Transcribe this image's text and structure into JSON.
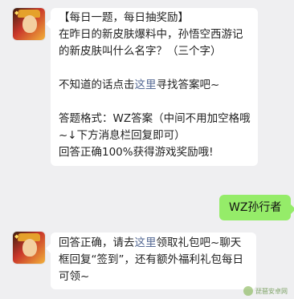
{
  "messages": {
    "first": {
      "title": "【每日一题，每日抽奖励】",
      "question": "在昨日的新皮肤爆料中，孙悟空西游记的新皮肤叫什么名字？（三个字）",
      "hint_before": "不知道的话点击",
      "hint_link": "这里",
      "hint_after": "寻找答案吧~",
      "format_text": "答题格式：WZ答案（中间不用加空格哦~↓下方消息栏回复即可）",
      "reward_text": "回答正确100%获得游戏奖励哦!"
    },
    "reply": {
      "text": "WZ孙行者"
    },
    "second": {
      "before": "回答正确，请去",
      "link": "这里",
      "after": "领取礼包吧~聊天框回复“签到”，还有额外福利礼包每日可领~"
    }
  },
  "watermark": {
    "text": "琵琶安卓网"
  },
  "colors": {
    "background": "#efeff1",
    "bubble_left": "#ffffff",
    "bubble_right": "#95ec69",
    "link": "#576b95"
  },
  "icons": {
    "avatar": "game-character-avatar",
    "badge": "game-logo-badge"
  }
}
